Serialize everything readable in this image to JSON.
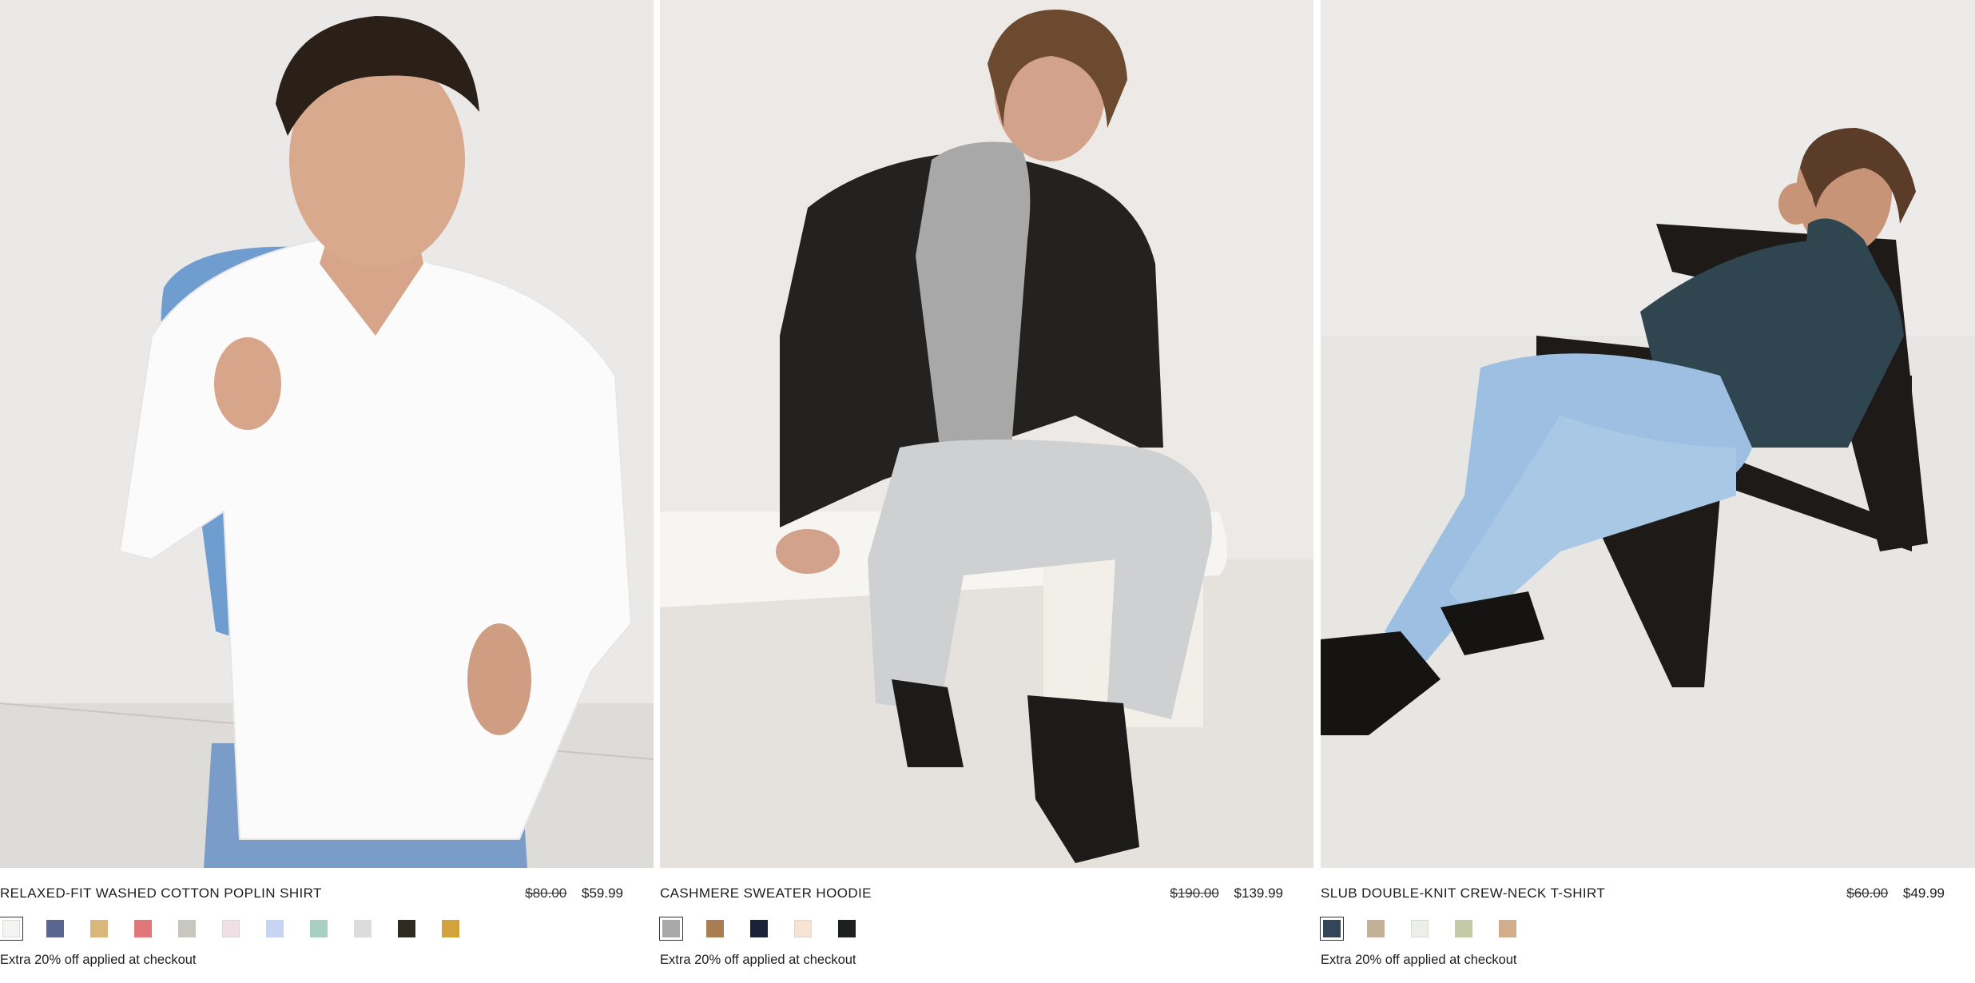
{
  "products": [
    {
      "name": "RELAXED-FIT WASHED COTTON POPLIN SHIRT",
      "was_price": "$80.00",
      "price": "$59.99",
      "promo": "Extra 20% off applied at checkout",
      "swatches": [
        "#f4f4f2",
        "#5a6590",
        "#d9b67a",
        "#e0787a",
        "#c8c6c0",
        "#f1dfe6",
        "#c8d4f4",
        "#a8cfc0",
        "#dcdcdc",
        "#2e2a20",
        "#d4a23c"
      ],
      "selected_swatch": 0
    },
    {
      "name": "CASHMERE SWEATER HOODIE",
      "was_price": "$190.00",
      "price": "$139.99",
      "promo": "Extra 20% off applied at checkout",
      "swatches": [
        "#a8a8a8",
        "#a97d52",
        "#1b2238",
        "#f6e3d2",
        "#1e1f20"
      ],
      "selected_swatch": 0
    },
    {
      "name": "SLUB DOUBLE-KNIT CREW-NECK T-SHIRT",
      "was_price": "$60.00",
      "price": "$49.99",
      "promo": "Extra 20% off applied at checkout",
      "swatches": [
        "#34445a",
        "#c2b196",
        "#ecefe8",
        "#c5caa6",
        "#d2ad8c"
      ],
      "selected_swatch": 0
    }
  ]
}
